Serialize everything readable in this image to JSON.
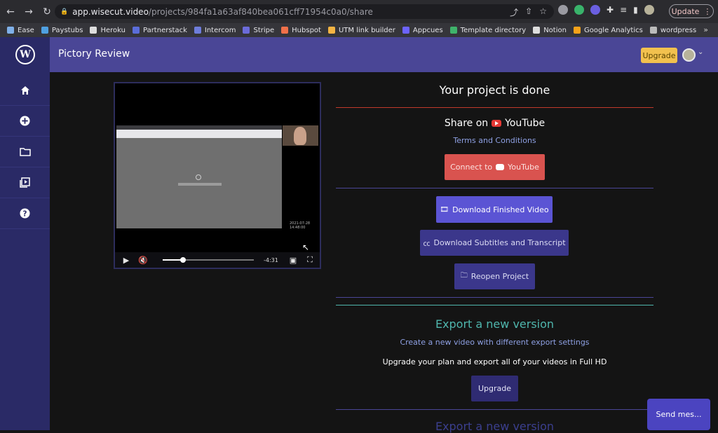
{
  "browser": {
    "url_host": "app.wisecut.video",
    "url_path": "/projects/984fa1a63af840bea061cff71954c0a0/share",
    "update_label": "Update",
    "bookmarks": [
      {
        "label": "Ease",
        "color": "#7fb0e8"
      },
      {
        "label": "Paystubs",
        "color": "#4fa0e0"
      },
      {
        "label": "Heroku",
        "color": "#dddddd"
      },
      {
        "label": "Partnerstack",
        "color": "#5b6dd9"
      },
      {
        "label": "Intercom",
        "color": "#6e7ddb"
      },
      {
        "label": "Stripe",
        "color": "#6b6bd9"
      },
      {
        "label": "Hubspot",
        "color": "#f0704a"
      },
      {
        "label": "UTM link builder",
        "color": "#f4b443"
      },
      {
        "label": "Appcues",
        "color": "#6c63ff"
      },
      {
        "label": "Template directory",
        "color": "#3fb36b"
      },
      {
        "label": "Notion",
        "color": "#dddddd"
      },
      {
        "label": "Google Analytics",
        "color": "#f6a21a"
      },
      {
        "label": "wordpress",
        "color": "#bbbbbb"
      }
    ],
    "more_label": "»"
  },
  "app": {
    "logo_letter": "W",
    "header_title": "Pictory Review",
    "upgrade_label": "Upgrade"
  },
  "player": {
    "time_remaining": "-4:31",
    "progress_fraction": 0.22,
    "stamp": "2021-07-28 14:48:00"
  },
  "share": {
    "title": "Your project is done",
    "share_on": "Share on",
    "youtube": "YouTube",
    "terms": "Terms and Conditions",
    "connect_to": "Connect to",
    "download_video": "Download Finished Video",
    "download_subs": "Download Subtitles and Transcript",
    "reopen": "Reopen Project"
  },
  "export": {
    "title": "Export a new version",
    "subtitle": "Create a new video with different export settings",
    "upgrade_text": "Upgrade your plan and export all of your videos in Full HD",
    "upgrade_button": "Upgrade",
    "title_repeat": "Export a new version"
  },
  "chat": {
    "label": "Send mes..."
  },
  "colors": {
    "sidebar": "#2a2a66",
    "header": "#4a4696",
    "danger": "#d9534f",
    "primary": "#5b54d4",
    "teal": "#4fb6ad",
    "upgrade": "#f2c14e"
  }
}
